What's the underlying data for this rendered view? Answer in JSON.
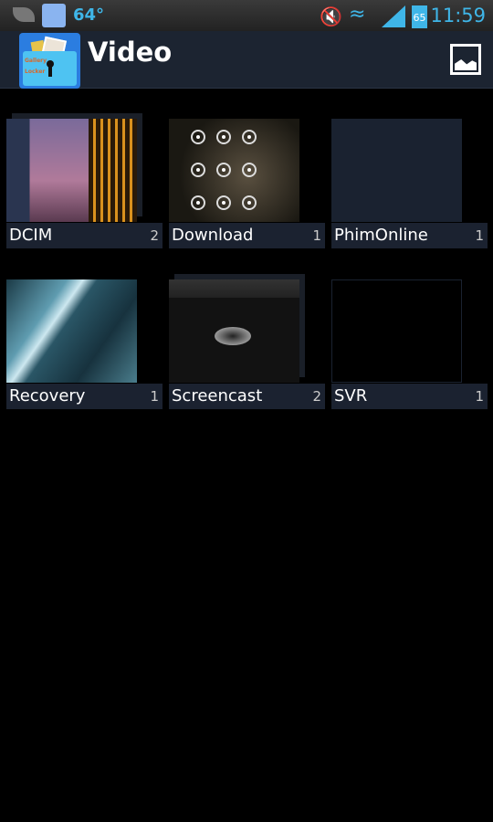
{
  "status_bar": {
    "temperature": "64°",
    "battery_level": "65",
    "time": "11:59",
    "icons": [
      "leaf-icon",
      "app-notification-icon",
      "muted-volume-icon",
      "wifi-lock-icon",
      "signal-icon",
      "battery-icon"
    ]
  },
  "header": {
    "title": "Video",
    "app_logo_text": "Gallery Locker",
    "action_icon": "image-icon"
  },
  "colors": {
    "accent": "#3fb6e8",
    "header_bg": "#1c2431",
    "label_bg": "#1b2230"
  },
  "albums": [
    {
      "name": "DCIM",
      "count": "2"
    },
    {
      "name": "Download",
      "count": "1"
    },
    {
      "name": "PhimOnline",
      "count": "1"
    },
    {
      "name": "Recovery",
      "count": "1"
    },
    {
      "name": "Screencast",
      "count": "2"
    },
    {
      "name": "SVR",
      "count": "1"
    }
  ]
}
